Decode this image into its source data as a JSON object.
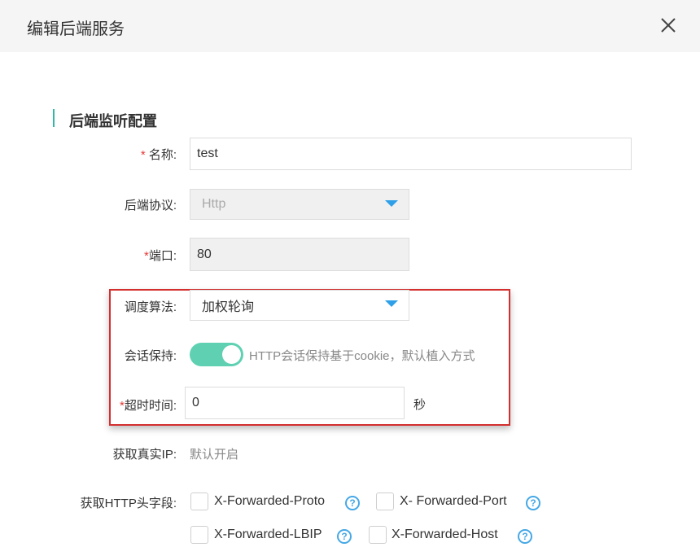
{
  "dialog": {
    "title": "编辑后端服务",
    "close_icon": "close-icon"
  },
  "section": {
    "title": "后端监听配置"
  },
  "form": {
    "name": {
      "required": "*",
      "label": " 名称:",
      "value": "test"
    },
    "protocol": {
      "label": "后端协议:",
      "value": "Http"
    },
    "port": {
      "required": "*",
      "label": "端口:",
      "value": "80"
    },
    "algorithm": {
      "label": "调度算法:",
      "value": "加权轮询"
    },
    "session": {
      "label": "会话保持:",
      "enabled": true,
      "hint": "HTTP会话保持基于cookie，默认植入方式"
    },
    "timeout": {
      "required": "*",
      "label": "超时时间:",
      "value": "0",
      "unit": "秒"
    },
    "real_ip": {
      "label": "获取真实IP:",
      "value": "默认开启"
    },
    "http_headers": {
      "label": "获取HTTP头字段:",
      "options": [
        {
          "label": "X-Forwarded-Proto",
          "checked": false
        },
        {
          "label": "X- Forwarded-Port",
          "checked": false
        },
        {
          "label": "X-Forwarded-LBIP",
          "checked": false
        },
        {
          "label": "X-Forwarded-Host",
          "checked": false
        }
      ],
      "help": "?"
    }
  },
  "colors": {
    "accent": "#2fb9a8",
    "toggle_on": "#5fd1b2",
    "caret": "#2fa0e8",
    "required": "#e53935",
    "highlight_box": "#d32f2f"
  }
}
